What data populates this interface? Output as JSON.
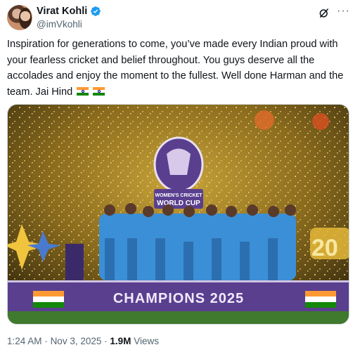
{
  "author": {
    "name": "Virat Kohli",
    "handle": "@imVkohli"
  },
  "tweet": {
    "text": "Inspiration for generations to come, you’ve made every Indian proud with your fearless cricket and belief throughout. You guys deserve all the accolades and enjoy the moment to the fullest. Well done Harman and the team. Jai Hind"
  },
  "photo": {
    "banner_text": "CHAMPIONS 2025",
    "trophy_text_1": "WOMEN'S CRICKET",
    "trophy_text_2": "WORLD CUP",
    "year_badge": "20"
  },
  "meta": {
    "time": "1:24 AM",
    "date": "Nov 3, 2025",
    "views_count": "1.9M",
    "views_label": "Views",
    "separator": "·"
  },
  "colors": {
    "text": "#0f1419",
    "secondary": "#536471",
    "verified": "#1d9bf0",
    "jersey": "#3b8fd6",
    "banner": "#5a3f8f"
  },
  "icons": [
    "verified-badge-icon",
    "grok-icon",
    "more-icon",
    "india-flag-icon"
  ]
}
